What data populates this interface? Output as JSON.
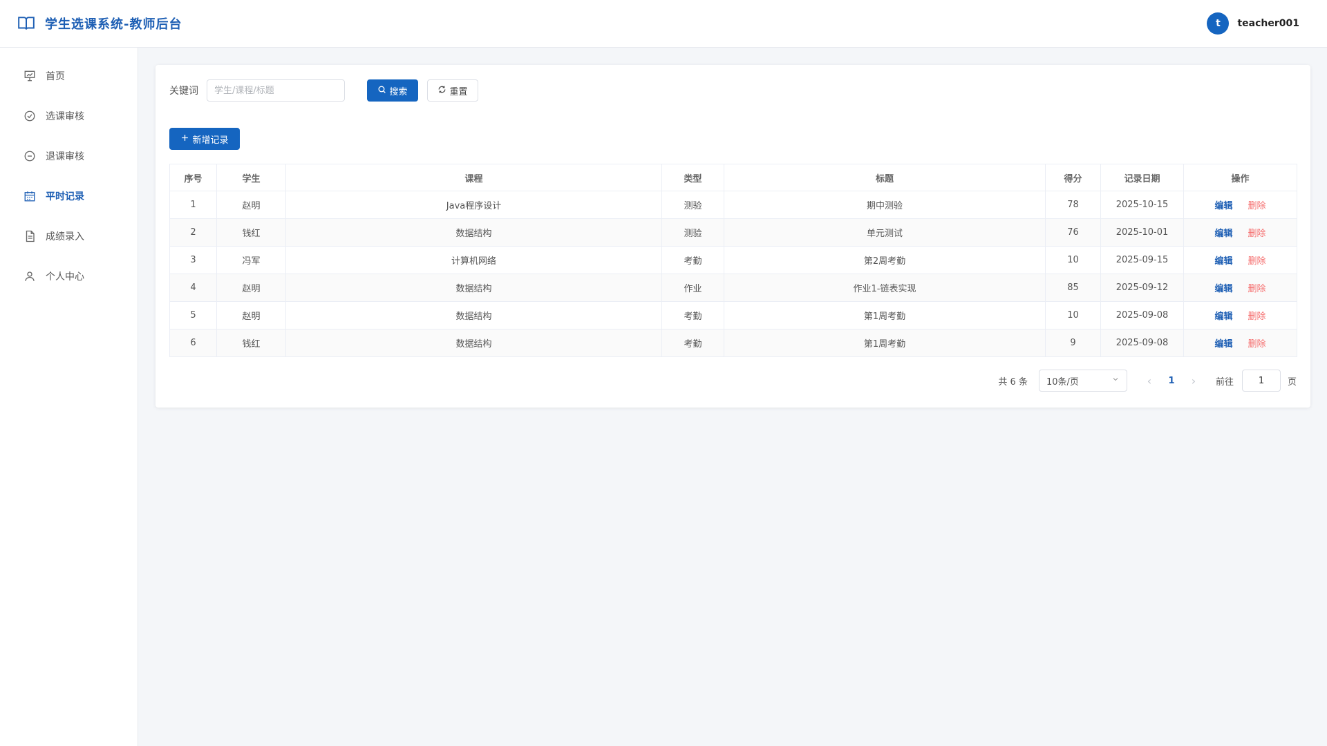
{
  "header": {
    "title": "学生选课系统-教师后台",
    "avatar_letter": "t",
    "username": "teacher001"
  },
  "sidebar": {
    "items": [
      {
        "label": "首页",
        "icon": "presentation-icon",
        "active": false
      },
      {
        "label": "选课审核",
        "icon": "check-circle-icon",
        "active": false
      },
      {
        "label": "退课审核",
        "icon": "minus-circle-icon",
        "active": false
      },
      {
        "label": "平时记录",
        "icon": "calendar-icon",
        "active": true
      },
      {
        "label": "成绩录入",
        "icon": "document-icon",
        "active": false
      },
      {
        "label": "个人中心",
        "icon": "user-icon",
        "active": false
      }
    ]
  },
  "search": {
    "label": "关键词",
    "placeholder": "学生/课程/标题",
    "value": "",
    "search_label": "搜索",
    "reset_label": "重置"
  },
  "toolbar": {
    "add_label": "新增记录"
  },
  "table": {
    "headers": [
      "序号",
      "学生",
      "课程",
      "类型",
      "标题",
      "得分",
      "记录日期",
      "操作"
    ],
    "edit_label": "编辑",
    "delete_label": "删除",
    "rows": [
      [
        "1",
        "赵明",
        "Java程序设计",
        "测验",
        "期中测验",
        "78",
        "2025-10-15"
      ],
      [
        "2",
        "钱红",
        "数据结构",
        "测验",
        "单元测试",
        "76",
        "2025-10-01"
      ],
      [
        "3",
        "冯军",
        "计算机网络",
        "考勤",
        "第2周考勤",
        "10",
        "2025-09-15"
      ],
      [
        "4",
        "赵明",
        "数据结构",
        "作业",
        "作业1-链表实现",
        "85",
        "2025-09-12"
      ],
      [
        "5",
        "赵明",
        "数据结构",
        "考勤",
        "第1周考勤",
        "10",
        "2025-09-08"
      ],
      [
        "6",
        "钱红",
        "数据结构",
        "考勤",
        "第1周考勤",
        "9",
        "2025-09-08"
      ]
    ]
  },
  "pagination": {
    "total_text": "共 6 条",
    "page_size": "10条/页",
    "current_page": "1",
    "goto_label": "前往",
    "goto_value": "1",
    "page_unit": "页"
  },
  "colors": {
    "primary": "#1565c0",
    "brand_text": "#1e5fb4",
    "danger": "#f56c6c"
  }
}
